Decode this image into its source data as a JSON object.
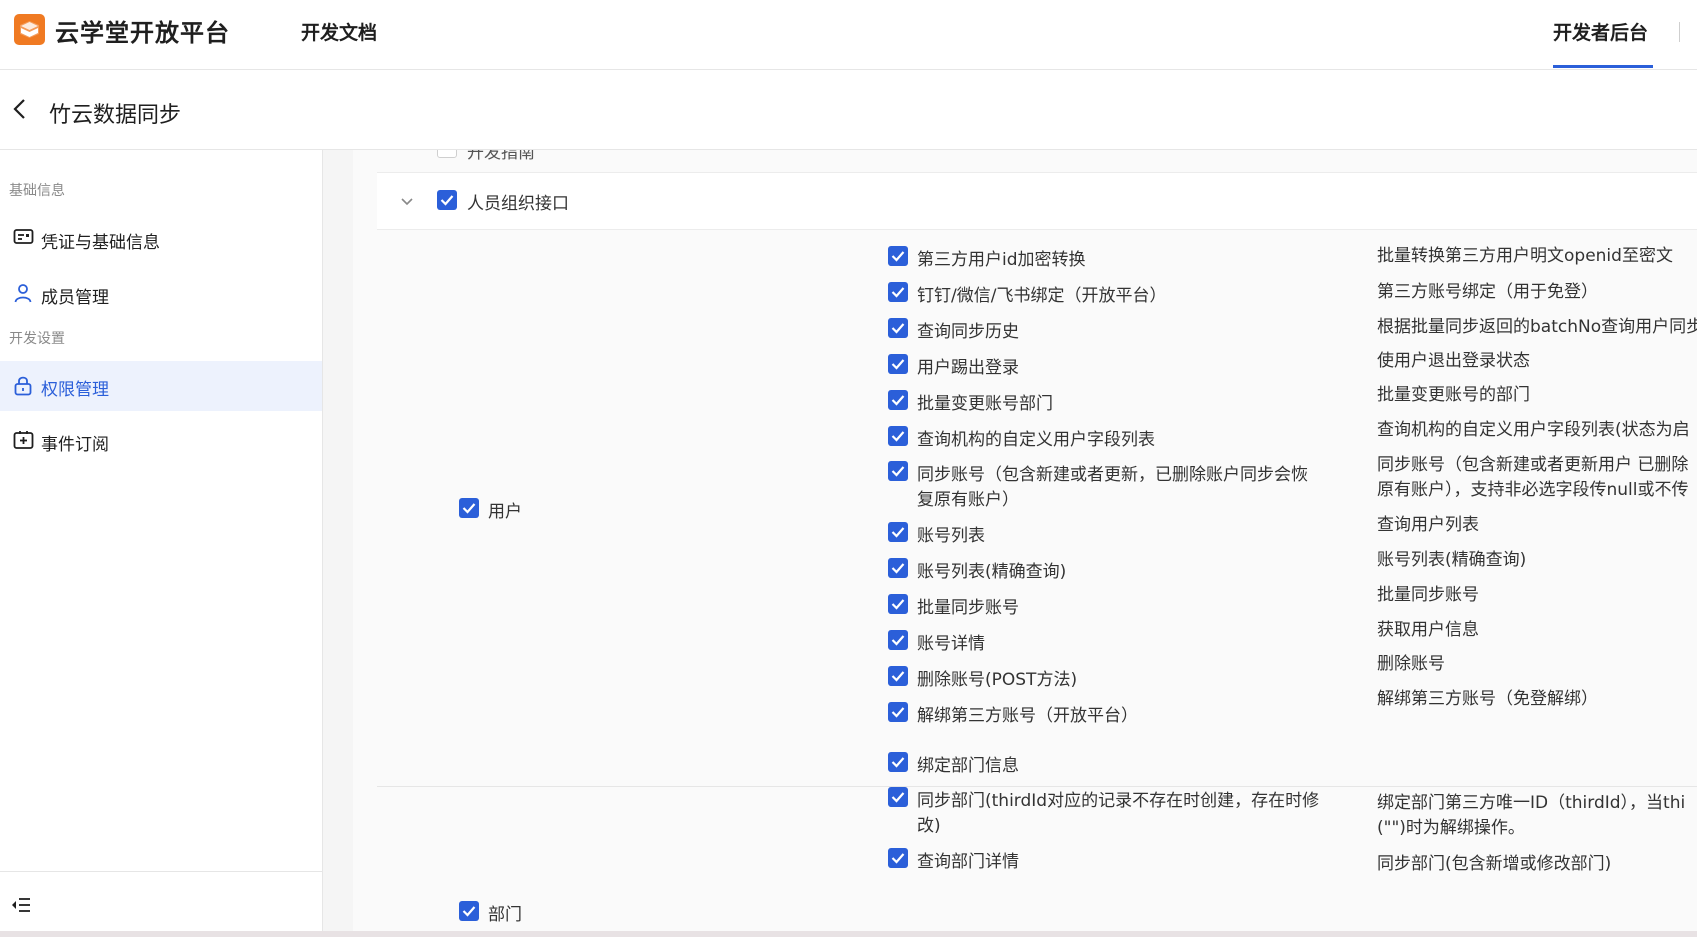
{
  "header": {
    "brand": "云学堂开放平台",
    "nav_docs": "开发文档",
    "nav_dev": "开发者后台"
  },
  "titlebar": {
    "title": "竹云数据同步"
  },
  "sidebar": {
    "group1": "基础信息",
    "group2": "开发设置",
    "items": [
      {
        "label": "凭证与基础信息",
        "icon": "id-card-icon"
      },
      {
        "label": "成员管理",
        "icon": "user-icon"
      },
      {
        "label": "权限管理",
        "icon": "lock-icon",
        "active": true
      },
      {
        "label": "事件订阅",
        "icon": "event-add-icon"
      }
    ]
  },
  "main": {
    "partial_top": "开发指南",
    "group_label": "人员组织接口",
    "user": {
      "label": "用户",
      "rows": [
        {
          "name": "第三方用户id加密转换",
          "desc": "批量转换第三方用户明文openid至密文"
        },
        {
          "name": "钉钉/微信/飞书绑定（开放平台）",
          "desc": "第三方账号绑定（用于免登）"
        },
        {
          "name": "查询同步历史",
          "desc": "根据批量同步返回的batchNo查询用户同步"
        },
        {
          "name": "用户踢出登录",
          "desc": "使用户退出登录状态"
        },
        {
          "name": "批量变更账号部门",
          "desc": "批量变更账号的部门"
        },
        {
          "name": "查询机构的自定义用户字段列表",
          "desc": "查询机构的自定义用户字段列表(状态为启"
        },
        {
          "name": "同步账号（包含新建或者更新，已删除账户同步会恢",
          "name2": "复原有账户）",
          "desc": "同步账号（包含新建或者更新用户 已删除",
          "desc2": "原有账户），支持非必选字段传null或不传"
        },
        {
          "name": "账号列表",
          "desc": "查询用户列表"
        },
        {
          "name": "账号列表(精确查询)",
          "desc": "账号列表(精确查询)"
        },
        {
          "name": "批量同步账号",
          "desc": "批量同步账号"
        },
        {
          "name": "账号详情",
          "desc": "获取用户信息"
        },
        {
          "name": "删除账号(POST方法)",
          "desc": "删除账号"
        },
        {
          "name": "解绑第三方账号（开放平台）",
          "desc": "解绑第三方账号（免登解绑）"
        }
      ]
    },
    "dept": {
      "label": "部门",
      "rows": [
        {
          "name": "绑定部门信息",
          "desc": ""
        },
        {
          "name": "同步部门(thirdId对应的记录不存在时创建，存在时修",
          "name2": "改)",
          "desc": "绑定部门第三方唯一ID（thirdId），当thi",
          "desc2": "(\"\")时为解绑操作。"
        },
        {
          "name": "查询部门详情",
          "desc": "同步部门(包含新增或修改部门)"
        }
      ]
    }
  }
}
